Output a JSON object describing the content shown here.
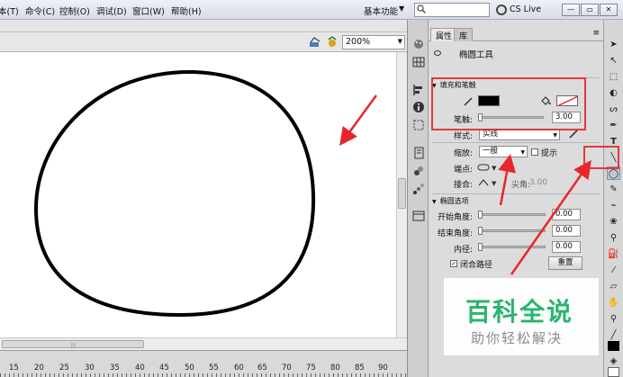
{
  "menubar": {
    "items": [
      "本(T)",
      "命令(C)",
      "控制(O)",
      "调试(D)",
      "窗口(W)",
      "帮助(H)"
    ],
    "workspace": "基本功能",
    "cs_live": "CS Live",
    "window_buttons": [
      "—",
      "▭",
      "✕"
    ]
  },
  "doc_toolbar": {
    "zoom": "200%"
  },
  "panel": {
    "tabs": [
      "属性",
      "库"
    ],
    "tool_name": "椭圆工具",
    "fill_stroke": {
      "section_title": "填充和笔触",
      "stroke_label": "笔触:",
      "stroke_value": "3.00",
      "style_label": "样式:",
      "style_value": "实线",
      "scale_label": "缩放:",
      "scale_value": "一般",
      "hint_label": "提示",
      "cap_label": "端点:",
      "join_label": "接合:",
      "miter_label": "尖角:",
      "miter_value": "3.00"
    },
    "ellipse_options": {
      "section_title": "椭圆选项",
      "start_angle_label": "开始角度:",
      "start_angle_value": "0.00",
      "end_angle_label": "结束角度:",
      "end_angle_value": "0.00",
      "inner_radius_label": "内径:",
      "inner_radius_value": "0.00",
      "close_path_label": "闭合路径",
      "reset_label": "重置"
    }
  },
  "timeline": {
    "ticks": [
      "15",
      "20",
      "25",
      "30",
      "35",
      "40",
      "45",
      "50",
      "55",
      "60",
      "65",
      "70",
      "75",
      "80",
      "85",
      "90"
    ]
  },
  "watermark": {
    "title": "百科全说",
    "subtitle": "助你轻松解决"
  },
  "colors": {
    "annotation_red": "#e8262c",
    "watermark_green": "#1fb36a"
  }
}
